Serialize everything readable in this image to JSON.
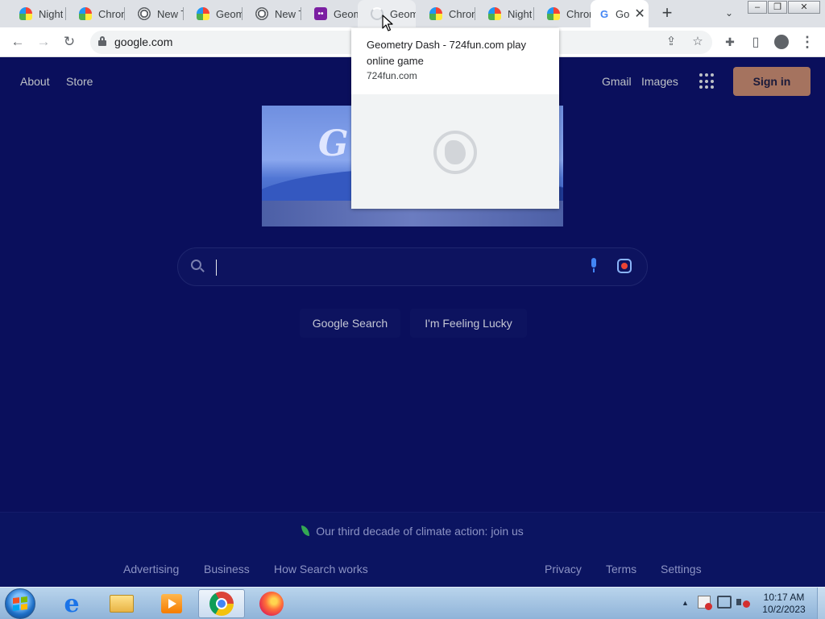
{
  "tabs": [
    {
      "title": "Night",
      "icon": "rainbow-icon"
    },
    {
      "title": "Chron",
      "icon": "rainbow-icon"
    },
    {
      "title": "New T",
      "icon": "chrome-icon"
    },
    {
      "title": "Geom",
      "icon": "rainbow-icon"
    },
    {
      "title": "New T",
      "icon": "chrome-icon"
    },
    {
      "title": "Geom",
      "icon": "purple-game-icon"
    },
    {
      "title": "Geom",
      "icon": "loading-spinner-icon"
    },
    {
      "title": "Chron",
      "icon": "rainbow-icon"
    },
    {
      "title": "Night",
      "icon": "rainbow-icon"
    },
    {
      "title": "Chron",
      "icon": "rainbow-icon"
    },
    {
      "title": "Go",
      "icon": "google-icon",
      "active": true
    }
  ],
  "tab_controls": {
    "new_tab": "+",
    "close": "✕",
    "tab_search": "⌄"
  },
  "window_controls": {
    "minimize": "‒",
    "restore": "❐",
    "close": "✕"
  },
  "toolbar": {
    "back": "←",
    "forward": "→",
    "reload": "↻",
    "url": "google.com",
    "share_icon": "⇪",
    "bookmark_icon": "☆",
    "extensions_icon": "✚",
    "sidepanel_icon": "▯",
    "profile_icon": "●",
    "menu_icon": "⋮"
  },
  "hover_card": {
    "title": "Geometry Dash - 724fun.com play online game",
    "domain": "724fun.com"
  },
  "google": {
    "header_left": [
      "About",
      "Store"
    ],
    "header_right": [
      "Gmail",
      "Images"
    ],
    "sign_in": "Sign in",
    "doodle_letter": "G",
    "search_value": "",
    "buttons": [
      "Google Search",
      "I'm Feeling Lucky"
    ],
    "climate": "Our third decade of climate action: join us",
    "footer_left": [
      "Advertising",
      "Business",
      "How Search works"
    ],
    "footer_right": [
      "Privacy",
      "Terms",
      "Settings"
    ]
  },
  "taskbar": {
    "apps": [
      "internet-explorer-icon",
      "file-explorer-icon",
      "media-player-icon",
      "chrome-icon",
      "firefox-icon"
    ],
    "active_app": "chrome-icon",
    "tray_up": "▲",
    "time": "10:17 AM",
    "date": "10/2/2023"
  },
  "colors": {
    "page_bg": "#0a0f5c",
    "signin_bg": "#a5735f",
    "tabstrip_bg": "#dee1e6"
  }
}
